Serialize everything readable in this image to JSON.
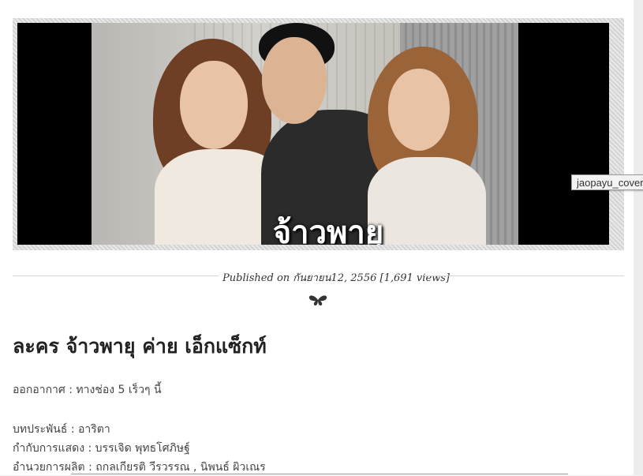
{
  "video": {
    "caption": "จ้าวพายุ"
  },
  "tooltip": {
    "text": "jaopayu_cover"
  },
  "meta": {
    "published_prefix": "Published on",
    "date": "กันยายน12, 2556",
    "views": "[1,691 views]"
  },
  "post": {
    "title": "ละคร จ้าวพายุ ค่าย เอ็กแซ็กท์",
    "airing": "ออกอากาศ : ทางช่อง 5 เร็วๆ นี้",
    "writer": "บทประพันธ์ : อาริตา",
    "director": "กำกับการแสดง : บรรเจิด พุทธโศภิษฐ์",
    "producer": "อำนวยการผลิต : ถกลเกียรติ วีรวรรณ , นิพนธ์ ผิวเณร"
  },
  "colors": {
    "page_bg": "#ffffff",
    "text": "#222222",
    "rule": "#d6d6d6"
  },
  "icons": {
    "ornament": "butterfly-ornament-icon"
  }
}
